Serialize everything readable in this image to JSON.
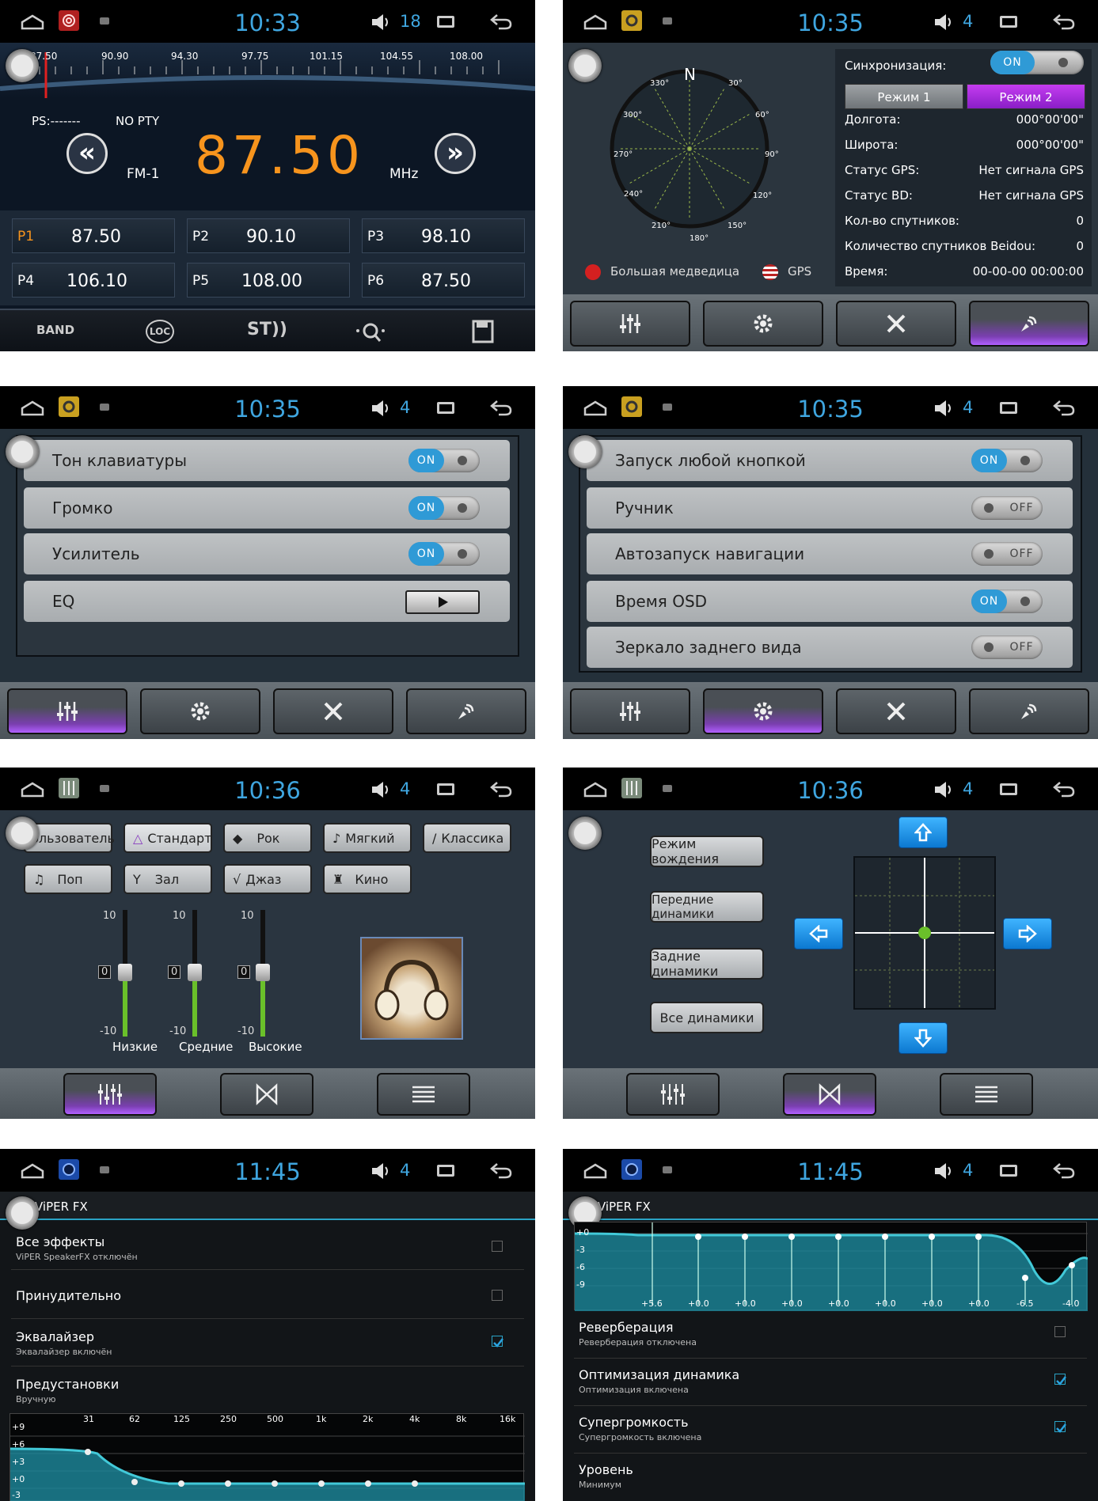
{
  "panels": {
    "radio": {
      "time": "10:33",
      "volume": "18",
      "scale": [
        "87.50",
        "90.90",
        "94.30",
        "97.75",
        "101.15",
        "104.55",
        "108.00"
      ],
      "ps": "PS:-------",
      "pty": "NO PTY",
      "band": "FM-1",
      "frequency": "87.50",
      "unit": "MHz",
      "presets": [
        {
          "label": "P1",
          "freq": "87.50"
        },
        {
          "label": "P2",
          "freq": "90.10"
        },
        {
          "label": "P3",
          "freq": "98.10"
        },
        {
          "label": "P4",
          "freq": "106.10"
        },
        {
          "label": "P5",
          "freq": "108.00"
        },
        {
          "label": "P6",
          "freq": "87.50"
        }
      ],
      "bottom": [
        "BAND",
        "LOC",
        "ST))"
      ]
    },
    "gps": {
      "time": "10:35",
      "volume": "4",
      "compass": {
        "north": "N",
        "angles": [
          "30°",
          "60°",
          "90°",
          "120°",
          "150°",
          "180°",
          "210°",
          "240°",
          "270°",
          "300°",
          "330°"
        ]
      },
      "sync_label": "Синхронизация:",
      "sync_state": "ON",
      "mode1": "Режим 1",
      "mode2": "Режим 2",
      "rows": [
        {
          "k": "Долгота:",
          "v": "000°00'00\""
        },
        {
          "k": "Широта:",
          "v": "000°00'00\""
        },
        {
          "k": "Статус GPS:",
          "v": "Нет сигнала GPS"
        },
        {
          "k": "Статус BD:",
          "v": "Нет сигнала GPS"
        },
        {
          "k": "Кол-во спутников:",
          "v": "0"
        },
        {
          "k": "Количество спутников Beidou:",
          "v": "0"
        },
        {
          "k": "Время:",
          "v": "00-00-00 00:00:00"
        }
      ],
      "legend_cn": "Большая медведица",
      "legend_us": "GPS"
    },
    "sound": {
      "time": "10:35",
      "volume": "4",
      "rows": [
        {
          "label": "Тон клавиатуры",
          "state": "ON"
        },
        {
          "label": "Громко",
          "state": "ON"
        },
        {
          "label": "Усилитель",
          "state": "ON"
        },
        {
          "label": "EQ",
          "state": "play"
        }
      ]
    },
    "general": {
      "time": "10:35",
      "volume": "4",
      "rows": [
        {
          "label": "Запуск любой кнопкой",
          "state": "ON"
        },
        {
          "label": "Ручник",
          "state": "OFF"
        },
        {
          "label": "Автозапуск навигации",
          "state": "OFF"
        },
        {
          "label": "Время OSD",
          "state": "ON"
        },
        {
          "label": "Зеркало заднего вида",
          "state": "OFF"
        }
      ]
    },
    "eq": {
      "time": "10:36",
      "volume": "4",
      "presets": [
        "Пользователь",
        "Стандарт",
        "Рок",
        "Мягкий",
        "Классика",
        "Поп",
        "Зал",
        "Джаз",
        "Кино"
      ],
      "faders": [
        {
          "label": "Низкие",
          "value": "0",
          "max": "10",
          "min": "-10"
        },
        {
          "label": "Средние",
          "value": "0",
          "max": "10",
          "min": "-10"
        },
        {
          "label": "Высокие",
          "value": "0",
          "max": "10",
          "min": "-10"
        }
      ]
    },
    "balance": {
      "time": "10:36",
      "volume": "4",
      "buttons": [
        "Режим вождения",
        "Передние динамики",
        "Задние динамики",
        "Все динамики"
      ]
    },
    "viper1": {
      "time": "11:45",
      "volume": "4",
      "title": "ViPER FX",
      "rows": [
        {
          "t": "Все эффекты",
          "s": "ViPER SpeakerFX отключён",
          "checked": false
        },
        {
          "t": "Принудительно",
          "s": "",
          "checked": false
        },
        {
          "t": "Эквалайзер",
          "s": "Эквалайзер включён",
          "checked": true
        },
        {
          "t": "Предустановки",
          "s": "Вручную",
          "checked": null
        }
      ],
      "freqs": [
        "31",
        "62",
        "125",
        "250",
        "500",
        "1k",
        "2k",
        "4k",
        "8k",
        "16k"
      ],
      "db": [
        "+9",
        "+6",
        "+3",
        "+0",
        "-3"
      ]
    },
    "viper2": {
      "time": "11:45",
      "volume": "4",
      "title": "ViPER FX",
      "db": [
        "+0",
        "-3",
        "-6",
        "-9"
      ],
      "gains": [
        "+5.6",
        "+0.0",
        "+0.0",
        "+0.0",
        "+0.0",
        "+0.0",
        "+0.0",
        "+0.0",
        "-6.5",
        "-4.0"
      ],
      "rows": [
        {
          "t": "Реверберация",
          "s": "Реверберация отключена",
          "checked": false
        },
        {
          "t": "Оптимизация динамика",
          "s": "Оптимизация включена",
          "checked": true
        },
        {
          "t": "Супергромкость",
          "s": "Супергромкость включена",
          "checked": true
        },
        {
          "t": "Уровень",
          "s": "Минимум",
          "checked": null
        }
      ]
    }
  }
}
